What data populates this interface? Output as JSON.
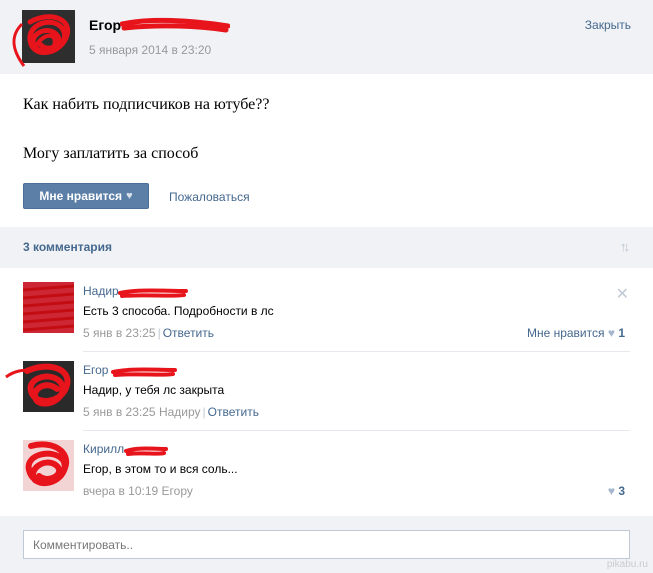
{
  "post": {
    "author_name": "Егор",
    "date": "5 января 2014 в 23:20",
    "close_label": "Закрыть",
    "text_line_1": "Как набить подписчиков на ютубе??",
    "text_line_2": "Могу заплатить за способ",
    "like_label": "Мне нравится",
    "report_label": "Пожаловаться"
  },
  "comments_section": {
    "count_label": "3 комментария",
    "sort_icon": "sort-arrows-icon"
  },
  "comments": [
    {
      "author": "Надир",
      "text": "Есть 3 способа. Подробности в лс",
      "date": "5 янв в 23:25",
      "reply_label": "Ответить",
      "like_label": "Мне нравится",
      "like_count": "1"
    },
    {
      "author": "Егор",
      "text": "Надир, у тебя лс закрыта",
      "date": "5 янв в 23:25",
      "reply_to": "Надиру",
      "reply_label": "Ответить"
    },
    {
      "author": "Кирилл",
      "text": "Егор, в этом то и вся соль...",
      "date": "вчера в 10:19",
      "reply_to": "Егору",
      "like_count": "3"
    }
  ],
  "footer": {
    "comment_placeholder": "Комментировать..",
    "watermark": "pikabu.ru"
  },
  "colors": {
    "link": "#45688e",
    "like_button": "#5b7fa6",
    "header_bg": "#f0f2f5",
    "scribble": "#e8141b"
  }
}
